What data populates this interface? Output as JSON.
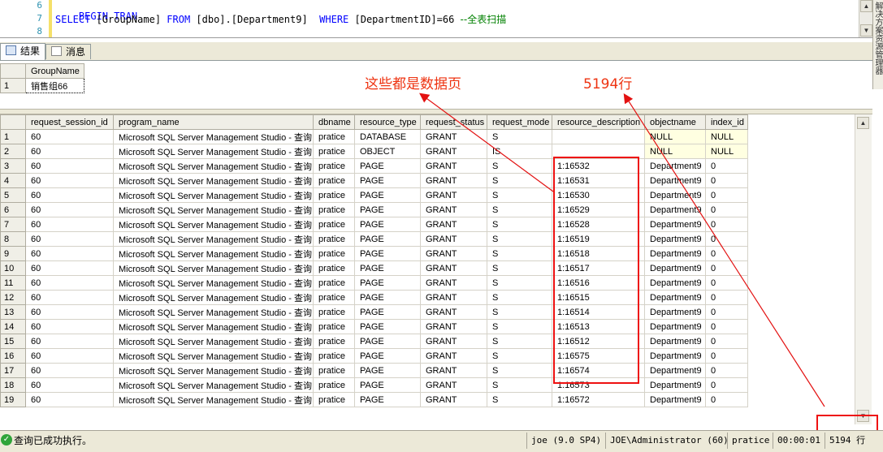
{
  "editor": {
    "lines": [
      {
        "num": "6",
        "keyword": "BEGIN TRAN",
        "text": "",
        "where": "",
        "rest": "",
        "comment": ""
      },
      {
        "num": "7",
        "keyword": "SELECT",
        "text": " [GroupName] ",
        "where": "FROM",
        "rest": " [dbo].[Department9]  ",
        "keyword2": "WHERE",
        "rest2": " [DepartmentID]=66 ",
        "comment": "--全表扫描"
      },
      {
        "num": "8",
        "keyword": "",
        "text": "",
        "where": "",
        "rest": "",
        "comment": ""
      }
    ]
  },
  "tabs": {
    "results": "结果",
    "messages": "消息"
  },
  "grid1": {
    "header": "GroupName",
    "row_num": "1",
    "value": "销售组66"
  },
  "grid2": {
    "columns": [
      "request_session_id",
      "program_name",
      "dbname",
      "resource_type",
      "request_status",
      "request_mode",
      "resource_description",
      "objectname",
      "index_id"
    ],
    "rows": [
      [
        "1",
        "60",
        "Microsoft SQL Server Management Studio - 查询",
        "pratice",
        "DATABASE",
        "GRANT",
        "S",
        "",
        "NULL",
        "NULL"
      ],
      [
        "2",
        "60",
        "Microsoft SQL Server Management Studio - 查询",
        "pratice",
        "OBJECT",
        "GRANT",
        "IS",
        "",
        "NULL",
        "NULL"
      ],
      [
        "3",
        "60",
        "Microsoft SQL Server Management Studio - 查询",
        "pratice",
        "PAGE",
        "GRANT",
        "S",
        "1:16532",
        "Department9",
        "0"
      ],
      [
        "4",
        "60",
        "Microsoft SQL Server Management Studio - 查询",
        "pratice",
        "PAGE",
        "GRANT",
        "S",
        "1:16531",
        "Department9",
        "0"
      ],
      [
        "5",
        "60",
        "Microsoft SQL Server Management Studio - 查询",
        "pratice",
        "PAGE",
        "GRANT",
        "S",
        "1:16530",
        "Department9",
        "0"
      ],
      [
        "6",
        "60",
        "Microsoft SQL Server Management Studio - 查询",
        "pratice",
        "PAGE",
        "GRANT",
        "S",
        "1:16529",
        "Department9",
        "0"
      ],
      [
        "7",
        "60",
        "Microsoft SQL Server Management Studio - 查询",
        "pratice",
        "PAGE",
        "GRANT",
        "S",
        "1:16528",
        "Department9",
        "0"
      ],
      [
        "8",
        "60",
        "Microsoft SQL Server Management Studio - 查询",
        "pratice",
        "PAGE",
        "GRANT",
        "S",
        "1:16519",
        "Department9",
        "0"
      ],
      [
        "9",
        "60",
        "Microsoft SQL Server Management Studio - 查询",
        "pratice",
        "PAGE",
        "GRANT",
        "S",
        "1:16518",
        "Department9",
        "0"
      ],
      [
        "10",
        "60",
        "Microsoft SQL Server Management Studio - 查询",
        "pratice",
        "PAGE",
        "GRANT",
        "S",
        "1:16517",
        "Department9",
        "0"
      ],
      [
        "11",
        "60",
        "Microsoft SQL Server Management Studio - 查询",
        "pratice",
        "PAGE",
        "GRANT",
        "S",
        "1:16516",
        "Department9",
        "0"
      ],
      [
        "12",
        "60",
        "Microsoft SQL Server Management Studio - 查询",
        "pratice",
        "PAGE",
        "GRANT",
        "S",
        "1:16515",
        "Department9",
        "0"
      ],
      [
        "13",
        "60",
        "Microsoft SQL Server Management Studio - 查询",
        "pratice",
        "PAGE",
        "GRANT",
        "S",
        "1:16514",
        "Department9",
        "0"
      ],
      [
        "14",
        "60",
        "Microsoft SQL Server Management Studio - 查询",
        "pratice",
        "PAGE",
        "GRANT",
        "S",
        "1:16513",
        "Department9",
        "0"
      ],
      [
        "15",
        "60",
        "Microsoft SQL Server Management Studio - 查询",
        "pratice",
        "PAGE",
        "GRANT",
        "S",
        "1:16512",
        "Department9",
        "0"
      ],
      [
        "16",
        "60",
        "Microsoft SQL Server Management Studio - 查询",
        "pratice",
        "PAGE",
        "GRANT",
        "S",
        "1:16575",
        "Department9",
        "0"
      ],
      [
        "17",
        "60",
        "Microsoft SQL Server Management Studio - 查询",
        "pratice",
        "PAGE",
        "GRANT",
        "S",
        "1:16574",
        "Department9",
        "0"
      ],
      [
        "18",
        "60",
        "Microsoft SQL Server Management Studio - 查询",
        "pratice",
        "PAGE",
        "GRANT",
        "S",
        "1:16573",
        "Department9",
        "0"
      ],
      [
        "19",
        "60",
        "Microsoft SQL Server Management Studio - 查询",
        "pratice",
        "PAGE",
        "GRANT",
        "S",
        "1:16572",
        "Department9",
        "0"
      ]
    ]
  },
  "annotations": {
    "data_pages": "这些都是数据页",
    "row_count": "5194行"
  },
  "right_strip_text": "解决方案资源管理器",
  "status": {
    "message": "查询已成功执行。",
    "server": "joe (9.0 SP4)",
    "user": "JOE\\Administrator (60)",
    "database": "pratice",
    "elapsed": "00:00:01",
    "rows": "5194 行"
  },
  "colors": {
    "annotation_red": "#e31111",
    "null_cell_bg": "#ffffe1",
    "keyword_blue": "#0000ff",
    "comment_green": "#008000"
  }
}
